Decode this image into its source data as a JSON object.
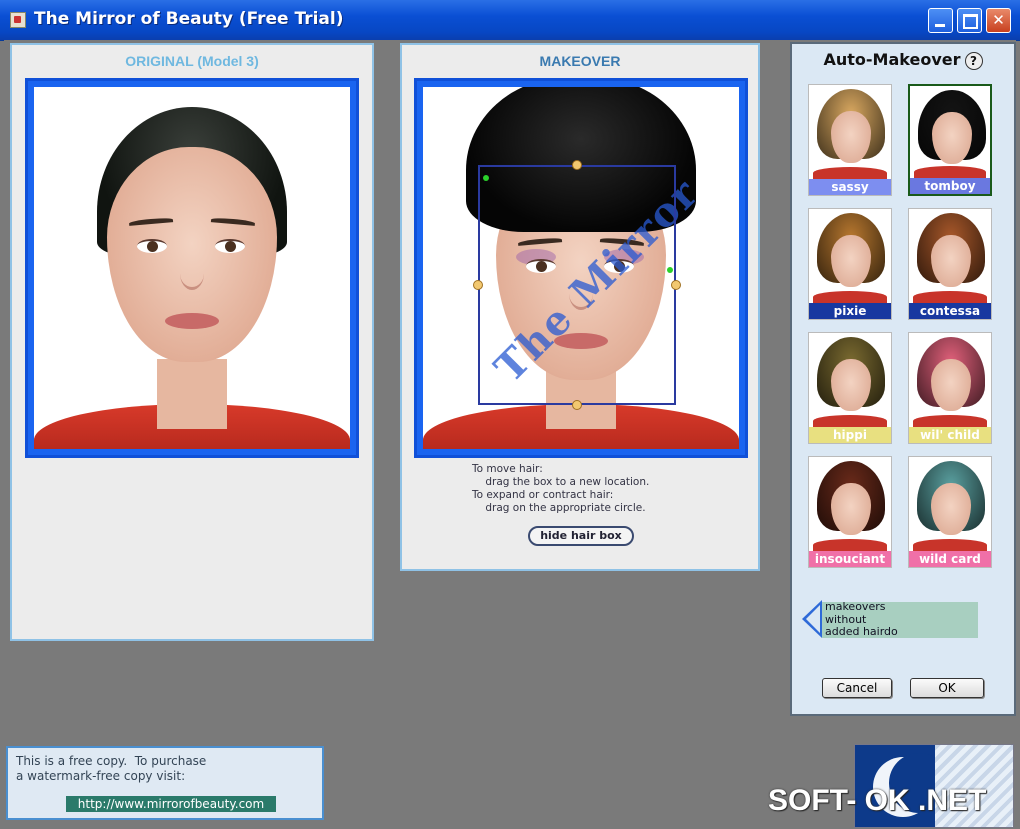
{
  "window": {
    "title": "The Mirror of Beauty (Free Trial)"
  },
  "original_panel": {
    "title": "ORIGINAL (Model 3)"
  },
  "makeover_panel": {
    "title": "MAKEOVER",
    "watermark": "The Mirror",
    "instructions": "To move hair:\n    drag the box to a new location.\nTo expand or contract hair:\n    drag on the appropriate circle.",
    "hide_hair_box_label": "hide hair box"
  },
  "auto_makeover": {
    "title": "Auto-Makeover",
    "help": "?",
    "styles": [
      {
        "label": "sassy",
        "hair_color": "#d9a860",
        "label_bg": "#7d8ef0",
        "selected": false
      },
      {
        "label": "tomboy",
        "hair_color": "#141414",
        "label_bg": "#6a78e0",
        "selected": true
      },
      {
        "label": "pixie",
        "hair_color": "#b8782f",
        "label_bg": "#1838a0",
        "selected": false
      },
      {
        "label": "contessa",
        "hair_color": "#a8582a",
        "label_bg": "#1838a0",
        "selected": false
      },
      {
        "label": "hippi",
        "hair_color": "#7a6a30",
        "label_bg": "#e8e080",
        "selected": false
      },
      {
        "label": "wil' child",
        "hair_color": "#e0607a",
        "label_bg": "#e8e080",
        "selected": false
      },
      {
        "label": "insouciant",
        "hair_color": "#6a2a1a",
        "label_bg": "#f070a8",
        "selected": false
      },
      {
        "label": "wild card",
        "hair_color": "#5aa0a0",
        "label_bg": "#f070a8",
        "selected": false
      }
    ],
    "no_hairdo_label": "makeovers\nwithout\nadded hairdo",
    "cancel_label": "Cancel",
    "ok_label": "OK"
  },
  "free_copy": {
    "text": "This is a free copy.  To purchase\na watermark-free copy visit:",
    "url": "http://www.mirrorofbeauty.com"
  },
  "overlay_watermark": "SOFT- OK .NET",
  "colors": {
    "titlebar": "#0a4fd4",
    "panel_border": "#8fc2e6",
    "photo_frame": "#1a64f0",
    "original_title": "#6fb8e0",
    "makeover_title": "#3a7ab0"
  }
}
